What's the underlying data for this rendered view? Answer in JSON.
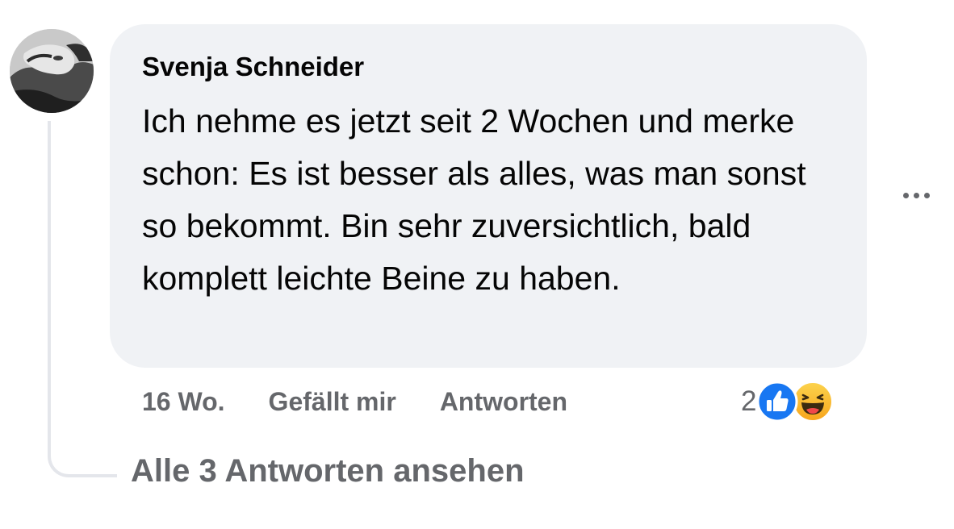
{
  "comment": {
    "author": "Svenja Schneider",
    "text": "Ich nehme es jetzt seit 2 Wochen und merke schon: Es ist besser als alles, was man sonst so bekommt. Bin sehr zuversichtlich, bald komplett leichte Beine zu haben.",
    "timestamp": "16 Wo.",
    "like_label": "Gefällt mir",
    "reply_label": "Antworten",
    "reaction_count": "2",
    "reactions": [
      "like-icon",
      "haha-icon"
    ],
    "view_replies_label": "Alle 3 Antworten ansehen"
  },
  "colors": {
    "bubble": "#f0f2f5",
    "secondary_text": "#65676b",
    "like_blue": "#1877f2",
    "haha_yellow": "#f7b125",
    "thread_line": "#e4e6eb"
  }
}
